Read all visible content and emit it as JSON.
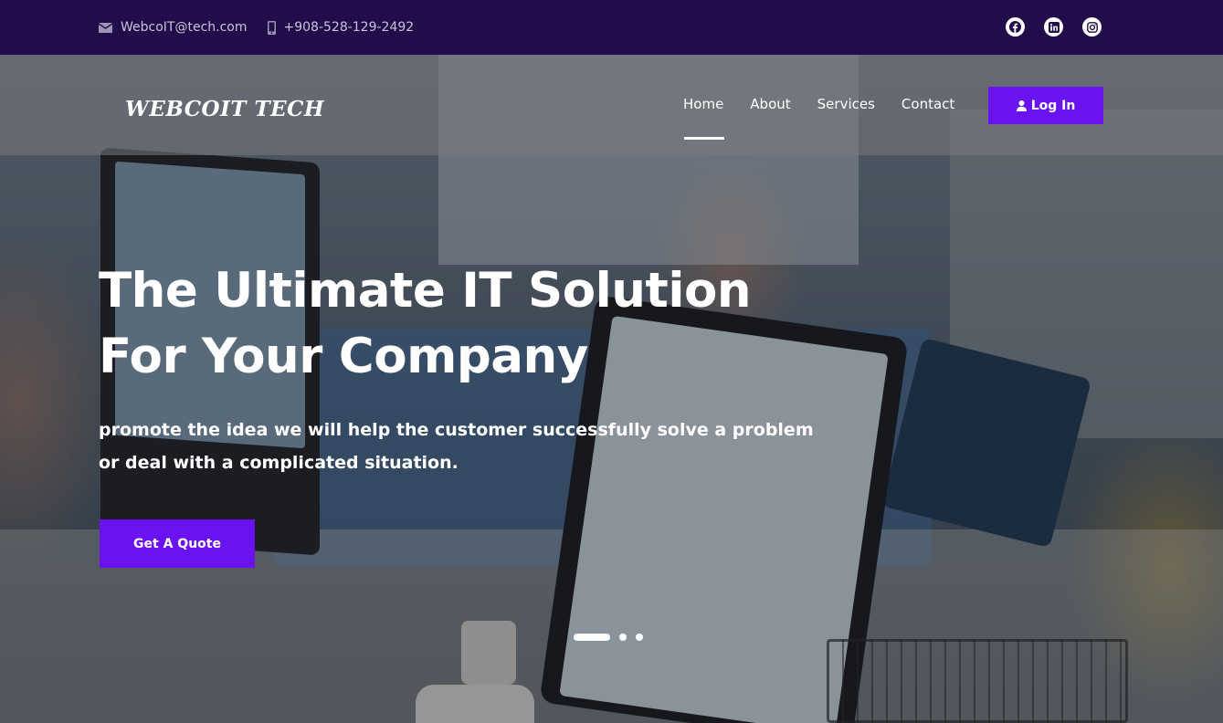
{
  "topbar": {
    "email": "WebcoIT@tech.com",
    "phone": "+908-528-129-2492",
    "email_icon": "envelope-icon",
    "phone_icon": "mobile-phone-icon",
    "socials": [
      "facebook-icon",
      "linkedin-icon",
      "instagram-icon"
    ]
  },
  "header": {
    "brand": "WEBCOIT TECH",
    "nav": [
      "Home",
      "About",
      "Services",
      "Contact"
    ],
    "active_nav": "Home",
    "login_label": "Log In",
    "login_icon": "user-icon"
  },
  "hero": {
    "headline": "The Ultimate IT Solution For Your Company",
    "subtitle": "promote the idea we will help the customer successfully solve a problem or deal with a complicated situation.",
    "cta_label": "Get A Quote",
    "slides_total": 3,
    "active_slide": 1
  },
  "colors": {
    "topbar_bg": "#220c4a",
    "accent": "#6a12f0",
    "text_light": "#ffffff"
  }
}
